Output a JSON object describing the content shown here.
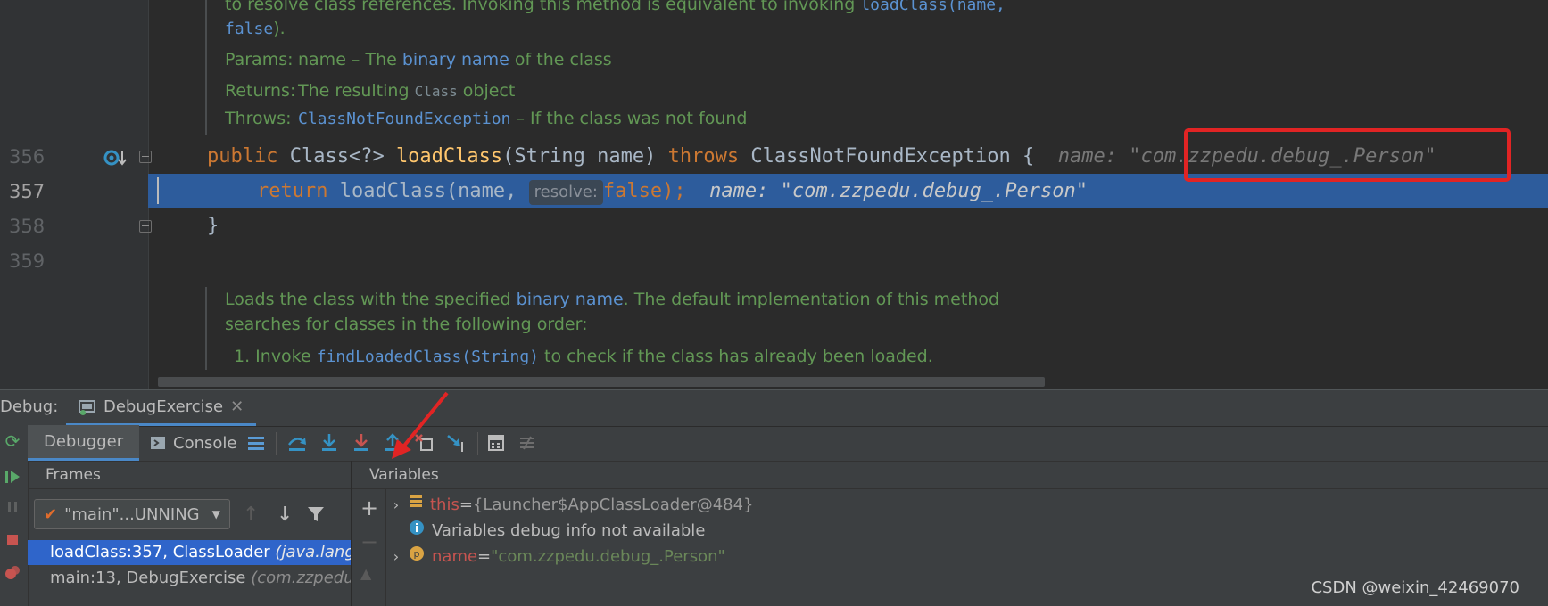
{
  "editor": {
    "doc_top": {
      "line1_text": "to resolve class references. Invoking this method is equivalent to invoking ",
      "line1_code": "loadClass(name,",
      "line2_code": "false",
      "line2_tail": ").",
      "params_label": "Params:",
      "params_name": "name",
      "params_dash": " – The ",
      "params_link": "binary name",
      "params_tail": " of the class",
      "returns_label": "Returns:",
      "returns_pre": "The resulting ",
      "returns_code": "Class",
      "returns_tail": " object",
      "throws_label": "Throws:",
      "throws_code": "ClassNotFoundException",
      "throws_tail": " – If the class was not found"
    },
    "lines": [
      {
        "number": "356",
        "kw1": "public",
        "type": " Class<?> ",
        "method": "loadClass",
        "params": "(String name) ",
        "kw2": "throws",
        "rest": " ClassNotFoundException {",
        "hint_label": "name: ",
        "hint_value": "\"com.zzpedu.debug_.Person\""
      },
      {
        "number": "357",
        "kw": "return",
        "call": " loadClass(name, ",
        "inlay": "resolve:",
        "arg": "false",
        "end": ");",
        "hint_label": "name: ",
        "hint_value": "\"com.zzpedu.debug_.Person\""
      },
      {
        "number": "358",
        "text": "}"
      },
      {
        "number": "359"
      }
    ],
    "doc_bottom": {
      "line1_pre": "Loads the class with the specified ",
      "line1_link": "binary name",
      "line1_tail": ". The default implementation of this method",
      "line2": "searches for classes in the following order:",
      "item_num": "1. Invoke ",
      "item_code": "findLoadedClass(String)",
      "item_tail": " to check if the class has already been loaded."
    }
  },
  "debug": {
    "title": "Debug:",
    "session_tab": "DebugExercise",
    "tabs": {
      "debugger": "Debugger",
      "console": "Console"
    },
    "frames_header": "Frames",
    "variables_header": "Variables",
    "thread": "\"main\"...UNNING",
    "frames": [
      {
        "method": "loadClass:357, ClassLoader ",
        "pkg": "(java.lang)"
      },
      {
        "method": "main:13, DebugExercise ",
        "pkg": "(com.zzpedu.d"
      }
    ],
    "variables": {
      "this_name": "this",
      "this_eq": " = ",
      "this_value": "{Launcher$AppClassLoader@484}",
      "info": "Variables debug info not available",
      "name_name": "name",
      "name_eq": " = ",
      "name_value": "\"com.zzpedu.debug_.Person\""
    }
  },
  "watermark": "CSDN @weixin_42469070",
  "colors": {
    "accent": "#2f65ca",
    "highlight_line": "#2d5c9c",
    "annotation_box": "#e12424",
    "arrow": "#e12424"
  }
}
